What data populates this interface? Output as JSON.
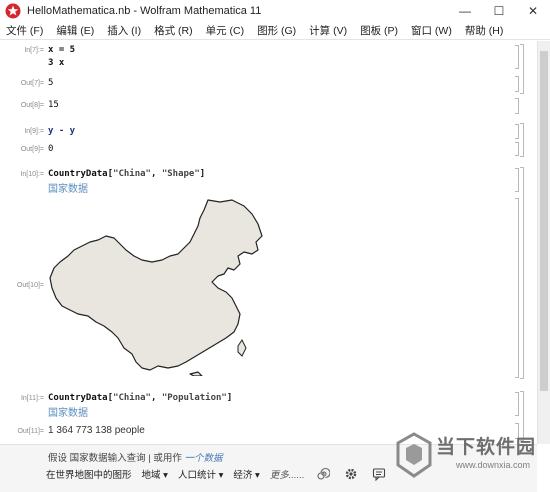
{
  "window": {
    "title": "HelloMathematica.nb - Wolfram Mathematica 11",
    "minimize": "—",
    "maximize": "☐",
    "close": "✕"
  },
  "menu": [
    "文件 (F)",
    "编辑 (E)",
    "插入 (I)",
    "格式 (R)",
    "单元 (C)",
    "图形 (G)",
    "计算 (V)",
    "图板 (P)",
    "窗口 (W)",
    "帮助 (H)"
  ],
  "cells": {
    "in7": {
      "label": "In[7]:=",
      "line1": "x = 5",
      "line2": "3 x"
    },
    "out7": {
      "label": "Out[7]=",
      "value": "5"
    },
    "out8": {
      "label": "Out[8]=",
      "value": "15"
    },
    "in9": {
      "label": "In[9]:=",
      "code": "y - y"
    },
    "out9": {
      "label": "Out[9]=",
      "value": "0"
    },
    "in10": {
      "label": "In[10]:=",
      "fn": "CountryData",
      "open": "[",
      "arg1": "\"China\"",
      "sep": ", ",
      "arg2": "\"Shape\"",
      "close": "]",
      "entity": "国家数据"
    },
    "out10": {
      "label": "Out[10]="
    },
    "in11": {
      "label": "In[11]:=",
      "fn": "CountryData",
      "open": "[",
      "arg1": "\"China\"",
      "sep": ", ",
      "arg2": "\"Population\"",
      "close": "]",
      "entity": "国家数据"
    },
    "out11": {
      "label": "Out[11]=",
      "value": "1 364 773 138 people"
    }
  },
  "suggestions": {
    "assume_prefix": "假设 国家数据输入查询 | 或用作",
    "assume_alt": "一个数据",
    "items": [
      "在世界地图中的图形",
      "地域 ▾",
      "人口统计 ▾",
      "经济 ▾",
      "更多......"
    ]
  },
  "watermark": {
    "text": "当下软件园",
    "url": "www.downxia.com"
  },
  "colors": {
    "map_fill": "#e8e6df",
    "entity_link": "#5b8dbf",
    "app_icon": "#d6262b"
  },
  "icons": [
    "mathematica-app-icon",
    "minimize-icon",
    "maximize-icon",
    "close-icon",
    "spiral-icon",
    "gear-icon",
    "chat-icon",
    "logo-icon"
  ]
}
